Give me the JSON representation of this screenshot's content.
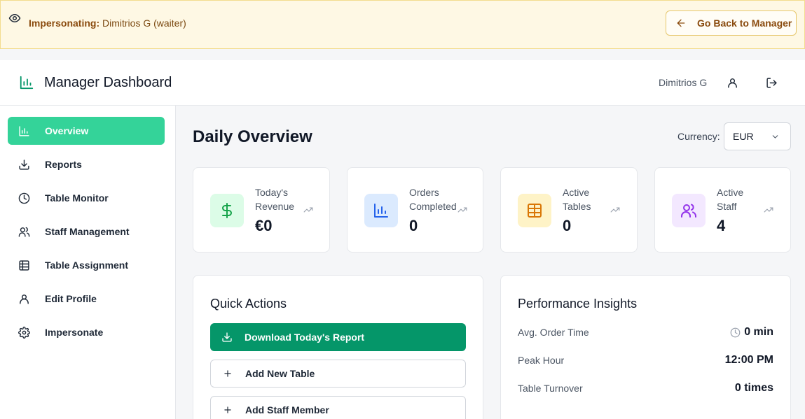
{
  "banner": {
    "eye_icon": "eye-icon",
    "prefix": "Impersonating:",
    "user": "Dimitrios G (waiter)",
    "back_button": "Go Back to Manager",
    "back_icon": "arrow-left-icon",
    "colors": {
      "background": "#fef8e4",
      "border": "#f3dc8e",
      "text": "#8a4b0e"
    }
  },
  "header": {
    "title": "Manager Dashboard",
    "logo_icon": "bar-chart-icon",
    "user_name": "Dimitrios G",
    "profile_icon": "user-icon",
    "logout_icon": "logout-icon"
  },
  "sidebar": {
    "items": [
      {
        "label": "Overview",
        "icon": "bar-chart-icon",
        "active": true
      },
      {
        "label": "Reports",
        "icon": "download-icon",
        "active": false
      },
      {
        "label": "Table Monitor",
        "icon": "clock-icon",
        "active": false
      },
      {
        "label": "Staff Management",
        "icon": "users-icon",
        "active": false
      },
      {
        "label": "Table Assignment",
        "icon": "grid-icon",
        "active": false
      },
      {
        "label": "Edit Profile",
        "icon": "user-icon",
        "active": false
      },
      {
        "label": "Impersonate",
        "icon": "gear-icon",
        "active": false
      }
    ],
    "active_color": "#34d399"
  },
  "main": {
    "title": "Daily Overview",
    "currency": {
      "label": "Currency:",
      "value": "EUR"
    },
    "stats": [
      {
        "label": "Today's Revenue",
        "value": "€0",
        "icon": "dollar-icon",
        "color": "#16a34a",
        "bg": "#dcfce7"
      },
      {
        "label": "Orders Completed",
        "value": "0",
        "icon": "bar-chart-icon",
        "color": "#2563eb",
        "bg": "#dbeafe"
      },
      {
        "label": "Active Tables",
        "value": "0",
        "icon": "grid-icon",
        "color": "#d97706",
        "bg": "#fef3c7"
      },
      {
        "label": "Active Staff",
        "value": "4",
        "icon": "users-icon",
        "color": "#9333ea",
        "bg": "#f3e8ff"
      }
    ],
    "quick_actions": {
      "title": "Quick Actions",
      "download_button": "Download Today's Report",
      "add_table_button": "Add New Table",
      "add_staff_button": "Add Staff Member",
      "primary_color": "#059669"
    },
    "insights": {
      "title": "Performance Insights",
      "rows": [
        {
          "label": "Avg. Order Time",
          "value": "0 min"
        },
        {
          "label": "Peak Hour",
          "value": "12:00 PM"
        },
        {
          "label": "Table Turnover",
          "value": "0 times"
        }
      ]
    }
  }
}
